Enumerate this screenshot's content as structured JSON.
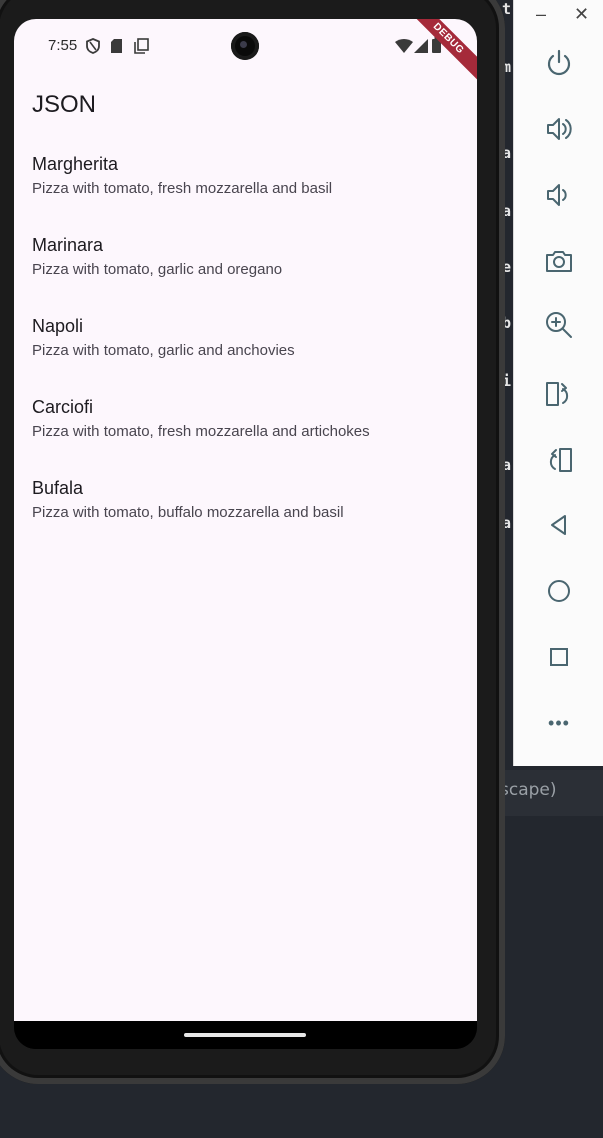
{
  "status_bar": {
    "time": "7:55",
    "icons": [
      "shield-icon",
      "sd-card-icon",
      "copy-icon",
      "wifi-icon",
      "signal-icon",
      "battery-icon"
    ]
  },
  "debug_banner": "DEBUG",
  "app": {
    "title": "JSON",
    "pizzas": [
      {
        "name": "Margherita",
        "description": "Pizza with tomato, fresh mozzarella and basil"
      },
      {
        "name": "Marinara",
        "description": "Pizza with tomato, garlic and oregano"
      },
      {
        "name": "Napoli",
        "description": "Pizza with tomato, garlic and anchovies"
      },
      {
        "name": "Carciofi",
        "description": "Pizza with tomato, fresh mozzarella and artichokes"
      },
      {
        "name": "Bufala",
        "description": "Pizza with tomato, buffalo mozzarella and basil"
      }
    ]
  },
  "emulator_toolbar": {
    "window_controls": {
      "minimize": "–",
      "close": "✕"
    },
    "buttons": [
      "power-icon",
      "volume-up-icon",
      "volume-down-icon",
      "camera-icon",
      "zoom-in-icon",
      "rotate-left-icon",
      "rotate-right-icon",
      "back-icon",
      "home-icon",
      "overview-icon",
      "more-icon"
    ],
    "more_label": "•••"
  },
  "ide": {
    "code_chars": [
      "t",
      "m",
      "a",
      "a",
      "e",
      "b",
      "i",
      "a",
      "a"
    ],
    "hint_text": "scape)"
  },
  "colors": {
    "app_background": "#fdf7fd",
    "debug_banner": "#a52a3a",
    "toolbar_icon": "#4a6670"
  }
}
